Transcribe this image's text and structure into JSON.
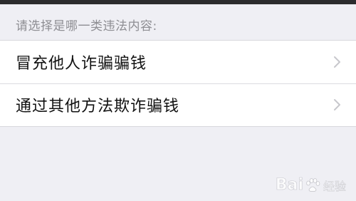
{
  "header": {
    "title": "请选择是哪一类违法内容:"
  },
  "options": [
    {
      "label": "冒充他人诈骗骗钱",
      "icon": "chevron-right-icon"
    },
    {
      "label": "通过其他方法欺诈骗钱",
      "icon": "chevron-right-icon"
    }
  ],
  "watermark": {
    "brand_left": "Bai",
    "brand_right": "经验"
  },
  "colors": {
    "background": "#efeff4",
    "cell": "#ffffff",
    "header_text": "#8e8e93",
    "label_text": "#111111",
    "chevron": "#c7c7cc"
  }
}
